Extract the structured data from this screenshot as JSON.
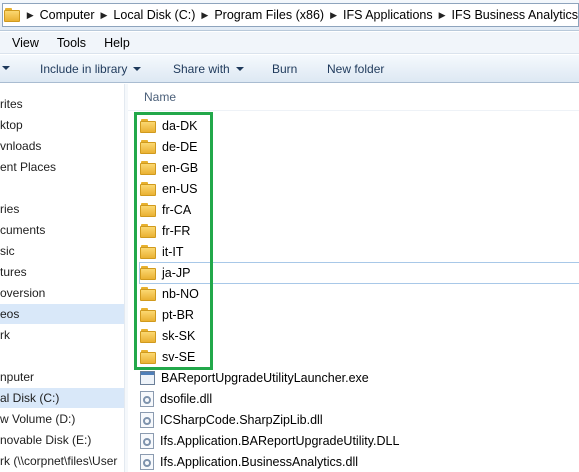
{
  "breadcrumb": [
    "Computer",
    "Local Disk (C:)",
    "Program Files (x86)",
    "IFS Applications",
    "IFS Business Analytics"
  ],
  "menu": [
    "View",
    "Tools",
    "Help"
  ],
  "commands": {
    "include": "Include in library",
    "share": "Share with",
    "burn": "Burn",
    "newfolder": "New folder"
  },
  "nav": [
    "rites",
    "ktop",
    "vnloads",
    "ent Places",
    "ries",
    "cuments",
    "sic",
    "tures",
    "oversion",
    "eos",
    "rk",
    "nputer",
    "al Disk (C:)",
    "w Volume (D:)",
    "novable Disk (E:)",
    "rk (\\\\corpnet\\files\\User"
  ],
  "content": {
    "column_name": "Name",
    "folders": [
      "da-DK",
      "de-DE",
      "en-GB",
      "en-US",
      "fr-CA",
      "fr-FR",
      "it-IT",
      "ja-JP",
      "nb-NO",
      "pt-BR",
      "sk-SK",
      "sv-SE"
    ],
    "files": [
      "BAReportUpgradeUtilityLauncher.exe",
      "dsofile.dll",
      "ICSharpCode.SharpZipLib.dll",
      "Ifs.Application.BAReportUpgradeUtility.DLL",
      "Ifs.Application.BusinessAnalytics.dll"
    ]
  },
  "colors": {
    "highlight": "#22a84a",
    "selection": "#d9e8f9"
  }
}
